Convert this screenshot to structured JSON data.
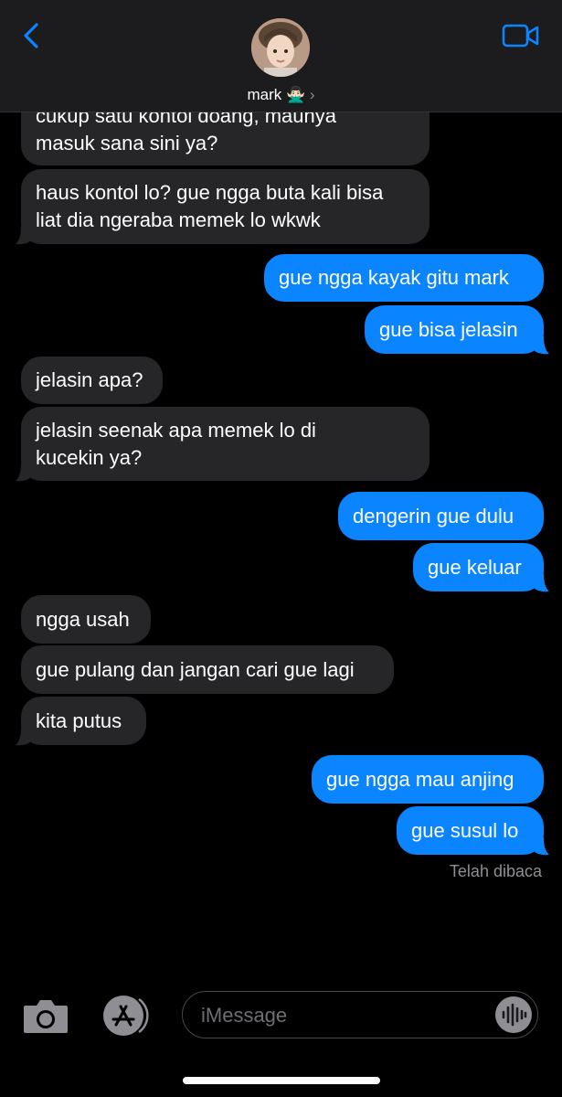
{
  "contact": {
    "name": "mark 🙅🏻‍♂️"
  },
  "messages": [
    {
      "dir": "in",
      "text": "cukup satu kontol doang, maunya\nmasuk sana sini ya?"
    },
    {
      "dir": "in",
      "text": "haus kontol lo? gue ngga buta kali bisa\nliat dia ngeraba memek lo wkwk"
    },
    {
      "dir": "out",
      "text": "gue ngga kayak gitu mark"
    },
    {
      "dir": "out",
      "text": "gue bisa jelasin"
    },
    {
      "dir": "in",
      "text": "jelasin apa?"
    },
    {
      "dir": "in",
      "text": "jelasin seenak apa memek lo di\nkucekin ya?"
    },
    {
      "dir": "out",
      "text": "dengerin gue dulu"
    },
    {
      "dir": "out",
      "text": "gue keluar"
    },
    {
      "dir": "in",
      "text": "ngga usah"
    },
    {
      "dir": "in",
      "text": "gue pulang dan jangan cari gue lagi"
    },
    {
      "dir": "in",
      "text": "kita putus"
    },
    {
      "dir": "out",
      "text": "gue ngga mau anjing"
    },
    {
      "dir": "out",
      "text": "gue susul lo"
    }
  ],
  "status": {
    "read_receipt": "Telah dibaca"
  },
  "composer": {
    "placeholder": "iMessage"
  },
  "colors": {
    "outgoing": "#0a84ff",
    "incoming": "#262628",
    "accent": "#0a84ff"
  },
  "icons": {
    "back": "chevron-left-icon",
    "video": "video-camera-icon",
    "camera": "camera-icon",
    "apps": "app-store-icon",
    "audio": "waveform-icon"
  }
}
